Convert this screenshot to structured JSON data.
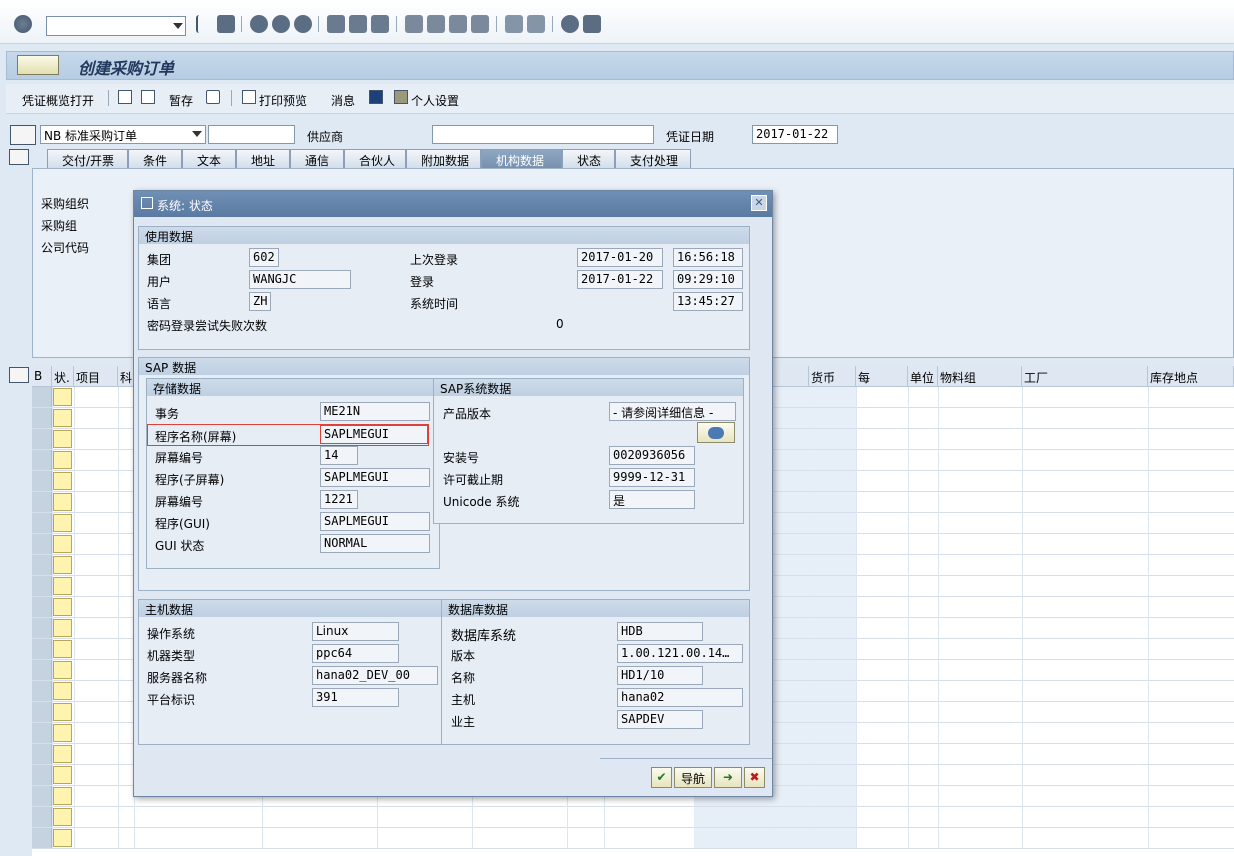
{
  "system_toolbar": {
    "command_field_value": "",
    "icons": [
      "enter-icon",
      "back-icon",
      "save-icon",
      "back-nav-icon",
      "exit-icon",
      "cancel-icon",
      "print-icon",
      "find-icon",
      "find-next-icon",
      "first-page-icon",
      "prev-page-icon",
      "next-page-icon",
      "last-page-icon",
      "create-session-icon",
      "shortcut-icon",
      "help-icon",
      "layout-icon"
    ]
  },
  "title": "创建采购订单",
  "app_toolbar": {
    "doc_overview": "凭证概览打开",
    "hold": "暂存",
    "print_preview": "打印预览",
    "messages": "消息",
    "personal_settings": "个人设置"
  },
  "header": {
    "order_type": "NB 标准采购订单",
    "vendor_label": "供应商",
    "vendor_value": "",
    "doc_date_label": "凭证日期",
    "doc_date_value": "2017-01-22"
  },
  "tabs": [
    {
      "label": "交付/开票"
    },
    {
      "label": "条件"
    },
    {
      "label": "文本"
    },
    {
      "label": "地址"
    },
    {
      "label": "通信"
    },
    {
      "label": "合伙人"
    },
    {
      "label": "附加数据"
    },
    {
      "label": "机构数据",
      "active": true
    },
    {
      "label": "状态"
    },
    {
      "label": "支付处理"
    }
  ],
  "org_fields": {
    "purch_org": "采购组织",
    "purch_group": "采购组",
    "company_code": "公司代码"
  },
  "grid": {
    "columns_left": [
      "B",
      "状.",
      "项目",
      "科"
    ],
    "columns_right": [
      "货币",
      "每",
      "单位",
      "物料组",
      "工厂",
      "库存地点"
    ]
  },
  "dialog": {
    "title": "系统: 状态",
    "usage": {
      "heading": "使用数据",
      "client_label": "集团",
      "client": "602",
      "user_label": "用户",
      "user": "WANGJC",
      "language_label": "语言",
      "language": "ZH",
      "last_login_label": "上次登录",
      "last_login_date": "2017-01-20",
      "last_login_time": "16:56:18",
      "login_label": "登录",
      "login_date": "2017-01-22",
      "login_time": "09:29:10",
      "system_time_label": "系统时间",
      "system_time": "13:45:27",
      "failed_label": "密码登录尝试失败次数",
      "failed": "0"
    },
    "sap": {
      "heading": "SAP 数据",
      "repo_heading": "存储数据",
      "transaction_label": "事务",
      "transaction": "ME21N",
      "program_screen_label": "程序名称(屏幕)",
      "program_screen": "SAPLMEGUI",
      "screen_no_label": "屏幕编号",
      "screen_no": "14",
      "program_sub_label": "程序(子屏幕)",
      "program_sub": "SAPLMEGUI",
      "screen_no2_label": "屏幕编号",
      "screen_no2": "1221",
      "program_gui_label": "程序(GUI)",
      "program_gui": "SAPLMEGUI",
      "gui_status_label": "GUI 状态",
      "gui_status": "NORMAL",
      "sys_heading": "SAP系统数据",
      "product_version_label": "产品版本",
      "product_version": "- 请参阅详细信息 -",
      "install_no_label": "安装号",
      "install_no": "0020936056",
      "license_exp_label": "许可截止期",
      "license_exp": "9999-12-31",
      "unicode_label": "Unicode 系统",
      "unicode": "是"
    },
    "host": {
      "heading": "主机数据",
      "os_label": "操作系统",
      "os": "Linux",
      "machine_label": "机器类型",
      "machine": "ppc64",
      "server_label": "服务器名称",
      "server": "hana02_DEV_00",
      "platform_label": "平台标识",
      "platform": "391"
    },
    "db": {
      "heading": "数据库数据",
      "system_label": "数据库系统",
      "system": "HDB",
      "release_label": "版本",
      "release": "1.00.121.00.14…",
      "name_label": "名称",
      "name": "HD1/10",
      "host_label": "主机",
      "host": "hana02",
      "owner_label": "业主",
      "owner": "SAPDEV"
    },
    "buttons": {
      "navigate": "导航"
    }
  },
  "colors": {
    "dialog_title": "#5a7aa2",
    "highlight_border": "#e0403a",
    "row_marker": "#fff3b0"
  }
}
